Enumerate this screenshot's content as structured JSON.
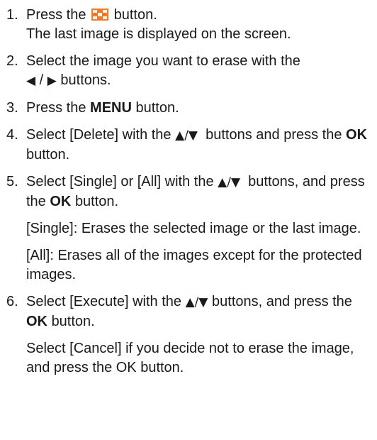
{
  "steps": [
    {
      "num": "1.",
      "before": "Press the",
      "icon": "playback-button-icon",
      "after": "button.",
      "line2": "The last image is displayed on the screen."
    },
    {
      "num": "2.",
      "text": "Select the image you want to erase with the",
      "left_arrow": "◀",
      "slash": "/",
      "right_arrow": "▶",
      "after": "buttons."
    },
    {
      "num": "3.",
      "before": "Press the",
      "bold": "MENU",
      "after": "button."
    },
    {
      "num": "4.",
      "before": "Select [Delete] with the",
      "arrows": "▲/▼",
      "mid": "buttons and press the",
      "bold": "OK",
      "after": "button."
    },
    {
      "num": "5.",
      "before": "Select [Single] or [All] with the",
      "arrows": "▲/▼",
      "mid": "buttons, and press the",
      "bold": "OK",
      "after": "button.",
      "notes": [
        "[Single]: Erases the selected image or the last image.",
        "[All]: Erases all of the images except for the protected images."
      ]
    },
    {
      "num": "6.",
      "before": "Select [Execute] with the",
      "arrows": "▲/▼",
      "mid": "buttons, and press the",
      "bold": "OK",
      "after": "button.",
      "notes": [
        "Select [Cancel] if you decide not to erase the image, and press the OK button."
      ]
    }
  ],
  "colors": {
    "icon_orange": "#f07a2a",
    "icon_light": "#ffffff"
  }
}
